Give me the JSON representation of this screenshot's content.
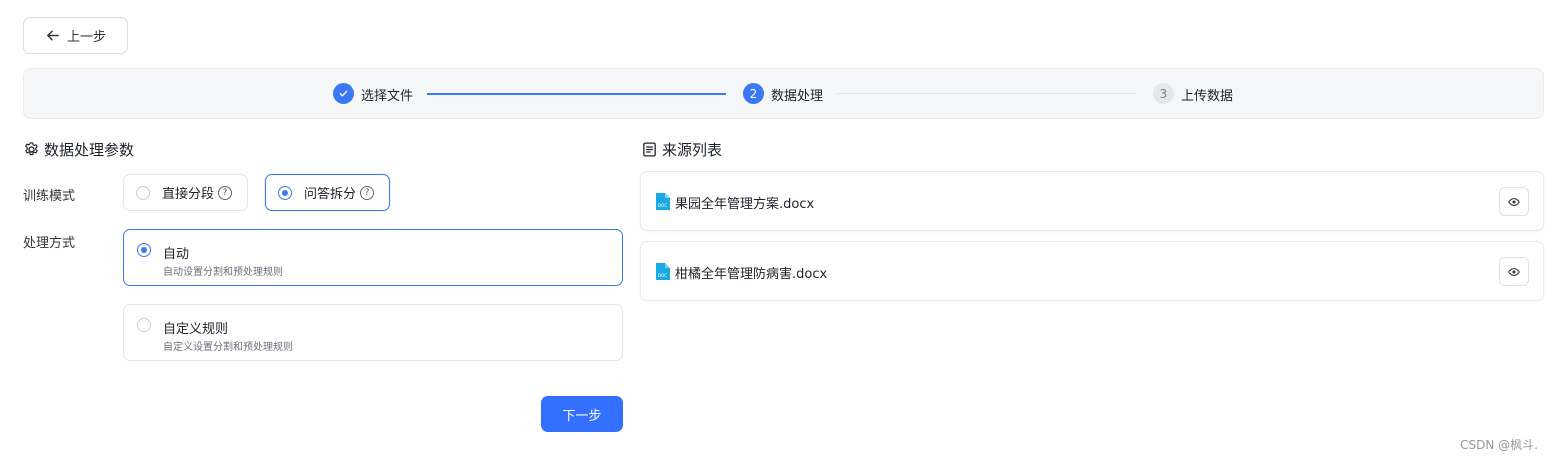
{
  "back_button": {
    "label": "上一步"
  },
  "steps": [
    {
      "index": "1",
      "label": "选择文件",
      "status": "done"
    },
    {
      "index": "2",
      "label": "数据处理",
      "status": "active"
    },
    {
      "index": "3",
      "label": "上传数据",
      "status": "pending"
    }
  ],
  "params_section": {
    "title": "数据处理参数",
    "training_mode": {
      "label": "训练模式",
      "options": [
        {
          "label": "直接分段",
          "selected": false
        },
        {
          "label": "问答拆分",
          "selected": true
        }
      ]
    },
    "processing_method": {
      "label": "处理方式",
      "options": [
        {
          "title": "自动",
          "desc": "自动设置分割和预处理规则",
          "selected": true
        },
        {
          "title": "自定义规则",
          "desc": "自定义设置分割和预处理规则",
          "selected": false
        }
      ]
    },
    "next_button": "下一步"
  },
  "source_section": {
    "title": "来源列表",
    "files": [
      {
        "name": "果园全年管理方案.docx"
      },
      {
        "name": "柑橘全年管理防病害.docx"
      }
    ]
  },
  "watermark": "CSDN @枫斗.",
  "colors": {
    "accent": "#3b78f6",
    "primary_button": "#3370ff",
    "doc_icon": "#1ba9e1"
  }
}
